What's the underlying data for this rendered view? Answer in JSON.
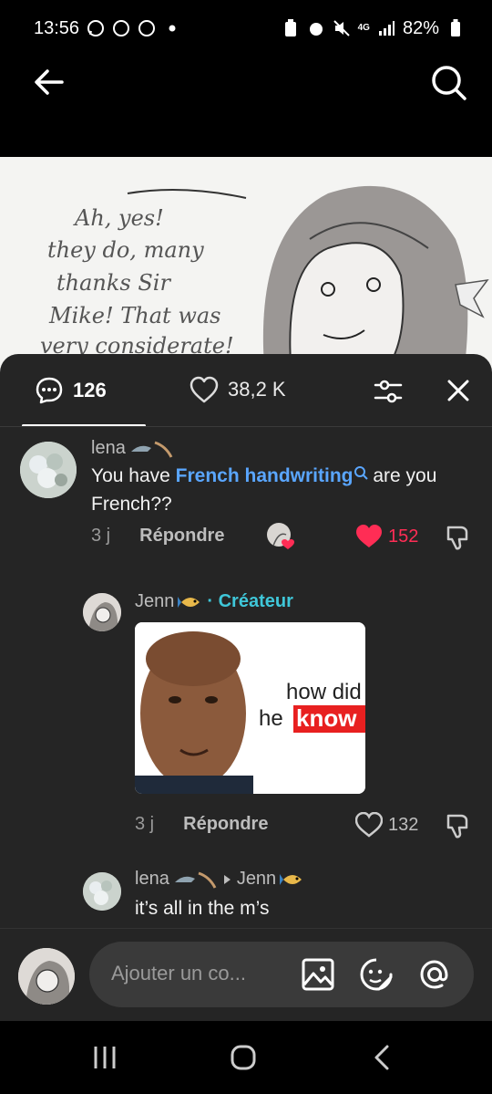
{
  "status_bar": {
    "time": "13:56",
    "network": "4G",
    "battery": "82%"
  },
  "sheet": {
    "tabs": {
      "comments_count": "126",
      "likes_count": "38,2 K"
    }
  },
  "comments": [
    {
      "username": "lena",
      "text_prefix": "You have ",
      "text_keyword": "French handwriting",
      "text_suffix": " are you",
      "text_line2": "French??",
      "time": "3 j",
      "reply_label": "Répondre",
      "likes": "152"
    },
    {
      "username": "Jenn",
      "creator_label": "· Créateur",
      "image_text_1": "how did",
      "image_text_2": "he",
      "image_text_3": "know",
      "time": "3 j",
      "reply_label": "Répondre",
      "likes": "132"
    },
    {
      "username": "lena",
      "reply_to": "Jenn",
      "text": "it’s all in the m’s"
    }
  ],
  "composer": {
    "placeholder": "Ajouter un co..."
  },
  "video_caption_lines": [
    "Ah, yes!",
    "they do, many",
    "thanks Sir",
    "Mike! That was",
    "very considerate!"
  ],
  "colors": {
    "background": "#252525",
    "creator_accent": "#3fc7d9",
    "keyword_link": "#5aa6ff",
    "like_red": "#ff2d55"
  }
}
